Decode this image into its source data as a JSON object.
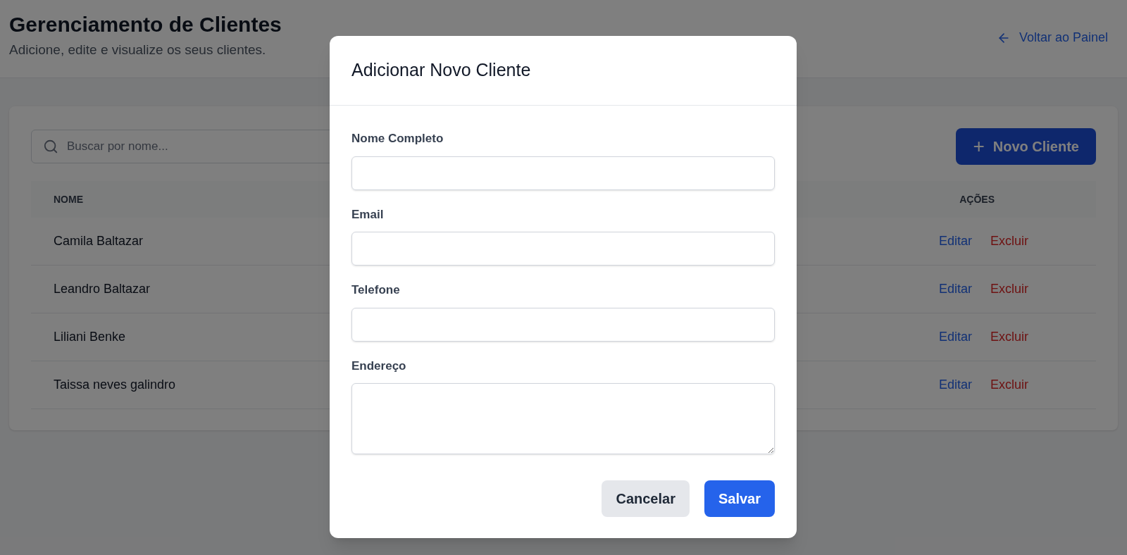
{
  "header": {
    "title": "Gerenciamento de Clientes",
    "subtitle": "Adicione, edite e visualize os seus clientes.",
    "back_link": "Voltar ao Painel"
  },
  "search": {
    "placeholder": "Buscar por nome..."
  },
  "new_button": {
    "label": "Novo Cliente",
    "icon": "+"
  },
  "table": {
    "columns": [
      "NOME",
      "AÇÕES"
    ],
    "rows": [
      {
        "name": "Camila Baltazar",
        "edit": "Editar",
        "delete": "Excluir"
      },
      {
        "name": "Leandro Baltazar",
        "edit": "Editar",
        "delete": "Excluir"
      },
      {
        "name": "Liliani Benke",
        "edit": "Editar",
        "delete": "Excluir"
      },
      {
        "name": "Taissa neves galindro",
        "edit": "Editar",
        "delete": "Excluir"
      }
    ]
  },
  "modal": {
    "title": "Adicionar Novo Cliente",
    "fields": [
      {
        "label": "Nome Completo",
        "kind": "input"
      },
      {
        "label": "Email",
        "kind": "input"
      },
      {
        "label": "Telefone",
        "kind": "input"
      },
      {
        "label": "Endereço",
        "kind": "textarea"
      }
    ],
    "cancel": "Cancelar",
    "save": "Salvar"
  }
}
